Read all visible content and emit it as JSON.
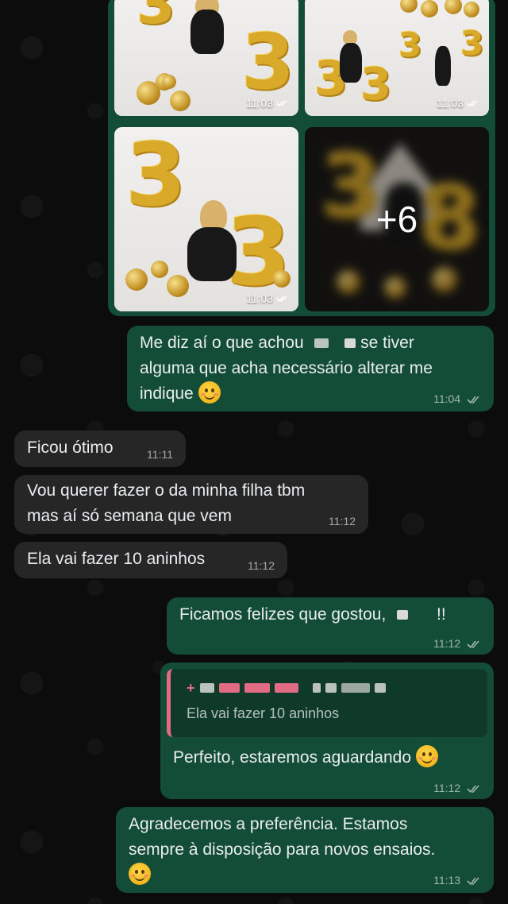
{
  "colors": {
    "outgoing": "#144d37",
    "incoming": "#262626",
    "background": "#0c0c0c",
    "quote_bar": "#e06b83"
  },
  "media": {
    "photos": [
      {
        "time": "11:03"
      },
      {
        "time": "11:03"
      },
      {
        "time": "11:03"
      },
      {
        "more": "+6"
      }
    ]
  },
  "messages": [
    {
      "dir": "out",
      "text_a": "Me diz aí o que achou",
      "text_b": "se tiver",
      "text_c": "alguma que acha necessário alterar me",
      "text_d": "indique",
      "time": "11:04"
    },
    {
      "dir": "in",
      "text": "Ficou ótimo",
      "time": "11:11"
    },
    {
      "dir": "in",
      "text_a": "Vou querer fazer o da minha filha tbm",
      "text_b": "mas aí só semana que vem",
      "time": "11:12"
    },
    {
      "dir": "in",
      "text": "Ela vai fazer 10 aninhos",
      "time": "11:12"
    },
    {
      "dir": "out",
      "text_a": "Ficamos felizes que gostou,",
      "text_b": "!!",
      "time": "11:12"
    },
    {
      "dir": "out",
      "quote_prefix": "+",
      "quote_text": "Ela vai fazer 10 aninhos",
      "text": "Perfeito, estaremos aguardando",
      "time": "11:12"
    },
    {
      "dir": "out",
      "text_a": "Agradecemos a preferência. Estamos",
      "text_b": "sempre à disposição para novos ensaios.",
      "time": "11:13"
    }
  ]
}
